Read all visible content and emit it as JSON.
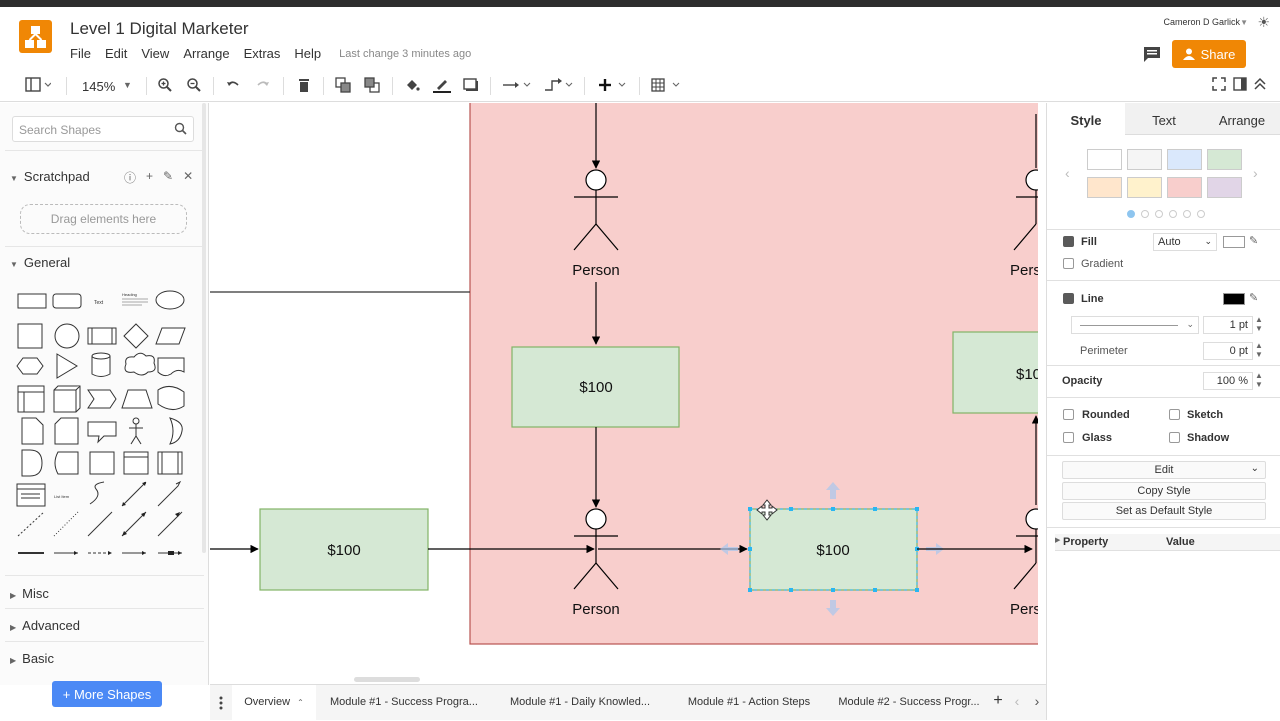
{
  "app": {
    "title": "Level 1 Digital Marketer",
    "menu": [
      "File",
      "Edit",
      "View",
      "Arrange",
      "Extras",
      "Help"
    ],
    "last_change": "Last change 3 minutes ago",
    "user": "Cameron D Garlick",
    "share_label": "Share"
  },
  "toolbar": {
    "zoom": "145%"
  },
  "sidebar": {
    "search_placeholder": "Search Shapes",
    "scratchpad": "Scratchpad",
    "drag_here": "Drag elements here",
    "general": "General",
    "sections": [
      "Misc",
      "Advanced",
      "Basic"
    ],
    "more_shapes": "+ More Shapes",
    "shape_text": "Text",
    "shape_heading": "Heading",
    "shape_list": "List Item"
  },
  "canvas": {
    "box_label": "$100",
    "box_label_clipped": "$10",
    "person_label": "Person",
    "person_label_clipped": "Pers"
  },
  "right_panel": {
    "tabs": [
      "Style",
      "Text",
      "Arrange"
    ],
    "swatches": [
      "#ffffff",
      "#f5f5f5",
      "#dae8fc",
      "#d5e8d4",
      "#ffe6cc",
      "#fff2cc",
      "#f8cecc",
      "#e1d5e7"
    ],
    "fill_label": "Fill",
    "fill_value": "Auto",
    "gradient_label": "Gradient",
    "line_label": "Line",
    "line_width": "1 pt",
    "perimeter_label": "Perimeter",
    "perimeter_value": "0 pt",
    "opacity_label": "Opacity",
    "opacity_value": "100 %",
    "rounded": "Rounded",
    "sketch": "Sketch",
    "glass": "Glass",
    "shadow": "Shadow",
    "edit": "Edit",
    "copy_style": "Copy Style",
    "set_default": "Set as Default Style",
    "property": "Property",
    "value": "Value"
  },
  "pages": [
    "Overview",
    "Module #1 - Success Progra...",
    "Module #1 - Daily Knowled...",
    "Module #1 - Action Steps",
    "Module #2 - Success Progr..."
  ],
  "colors": {
    "accent": "#f08705",
    "box_fill": "#d5e8d4",
    "box_stroke": "#82b366",
    "container_fill": "#f8cecc",
    "container_stroke": "#b85450",
    "selection": "#29b6f2"
  }
}
